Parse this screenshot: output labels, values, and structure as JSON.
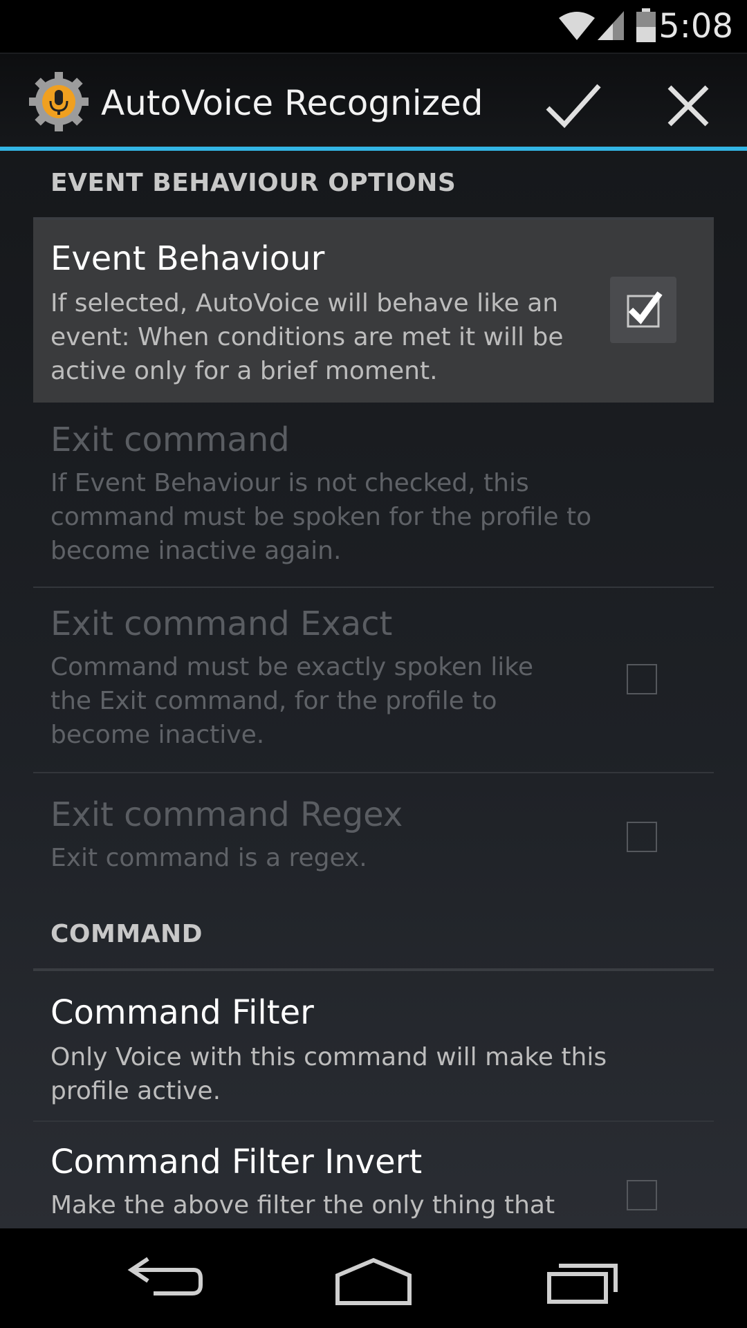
{
  "status_bar": {
    "time": "5:08",
    "icons": [
      "wifi-icon",
      "signal-icon",
      "battery-icon"
    ]
  },
  "action_bar": {
    "title": "AutoVoice Recognized",
    "app_icon": "autovoice-gear-mic-icon",
    "confirm_icon": "checkmark-icon",
    "cancel_icon": "close-icon"
  },
  "sections": {
    "event": {
      "header": "EVENT BEHAVIOUR OPTIONS",
      "items": [
        {
          "title": "Event Behaviour",
          "summary": [
            "If selected, AutoVoice will behave like an",
            "event: When conditions are met it will be",
            "active only for a brief moment."
          ],
          "checked": true,
          "enabled": true
        },
        {
          "title": "Exit command",
          "summary": [
            "If Event Behaviour is not checked, this",
            "command must be spoken for the profile to",
            "become inactive again."
          ],
          "enabled": false
        },
        {
          "title": "Exit command Exact",
          "summary": [
            "Command must be exactly spoken like",
            "the Exit command, for the profile to",
            "become inactive."
          ],
          "checked": false,
          "enabled": false
        },
        {
          "title": "Exit command Regex",
          "summary": [
            "Exit command is a regex."
          ],
          "checked": false,
          "enabled": false
        }
      ]
    },
    "command": {
      "header": "COMMAND",
      "items": [
        {
          "title": "Command Filter",
          "summary": [
            "Only Voice with this command will make this",
            "profile active."
          ],
          "enabled": true
        },
        {
          "title": "Command Filter Invert",
          "summary": [
            "Make the above filter the only thing that"
          ],
          "checked": false,
          "enabled": true
        }
      ]
    }
  },
  "nav_bar": {
    "icons": [
      "back-icon",
      "home-icon",
      "recent-apps-icon"
    ]
  },
  "colors": {
    "accent": "#33b5e5",
    "background": "#1e2126",
    "highlight": "#3a3b3d"
  }
}
